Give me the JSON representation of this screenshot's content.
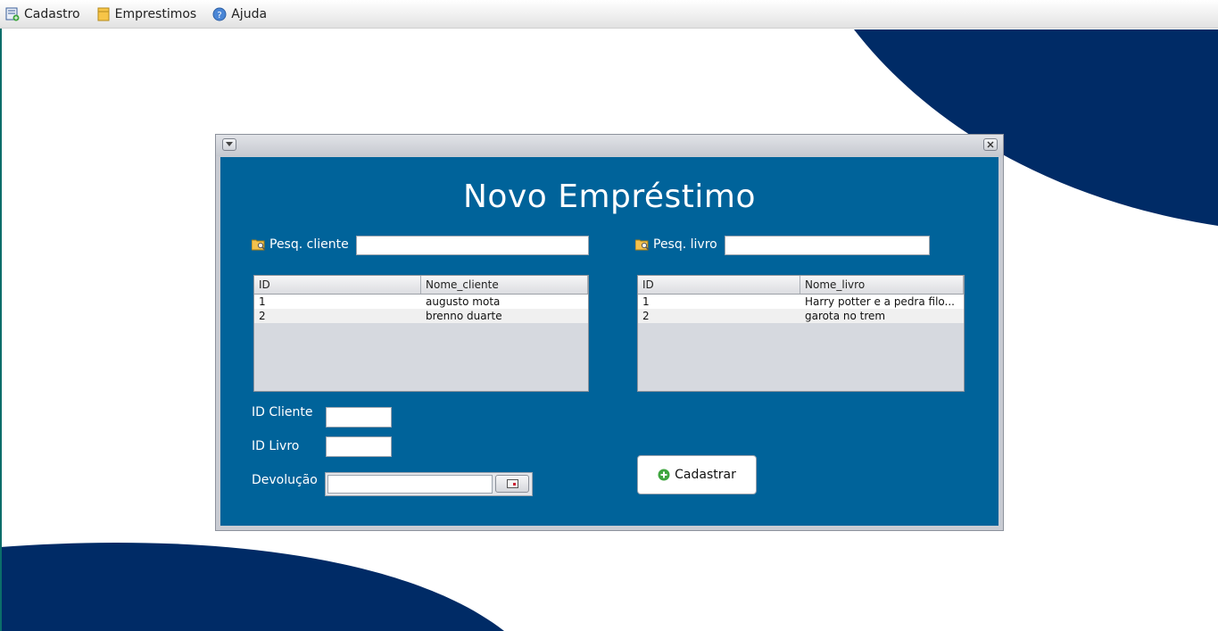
{
  "menubar": {
    "items": [
      {
        "label": "Cadastro",
        "icon": "form-add-icon"
      },
      {
        "label": "Emprestimos",
        "icon": "notebook-icon"
      },
      {
        "label": "Ajuda",
        "icon": "help-icon"
      }
    ]
  },
  "dialog": {
    "title": "Novo Empréstimo",
    "client_search": {
      "label": "Pesq. cliente",
      "value": ""
    },
    "book_search": {
      "label": "Pesq. livro",
      "value": ""
    },
    "clients_table": {
      "columns": [
        "ID",
        "Nome_cliente"
      ],
      "rows": [
        [
          "1",
          "augusto mota"
        ],
        [
          "2",
          "brenno duarte"
        ]
      ]
    },
    "books_table": {
      "columns": [
        "ID",
        "Nome_livro"
      ],
      "rows": [
        [
          "1",
          "Harry potter e a pedra filo..."
        ],
        [
          "2",
          "garota no trem"
        ]
      ]
    },
    "id_cliente_label": "ID Cliente",
    "id_livro_label": "ID Livro",
    "devolucao_label": "Devolução",
    "submit_label": "Cadastrar"
  },
  "colors": {
    "panel_blue": "#00639a",
    "decor_navy": "#002b66"
  }
}
